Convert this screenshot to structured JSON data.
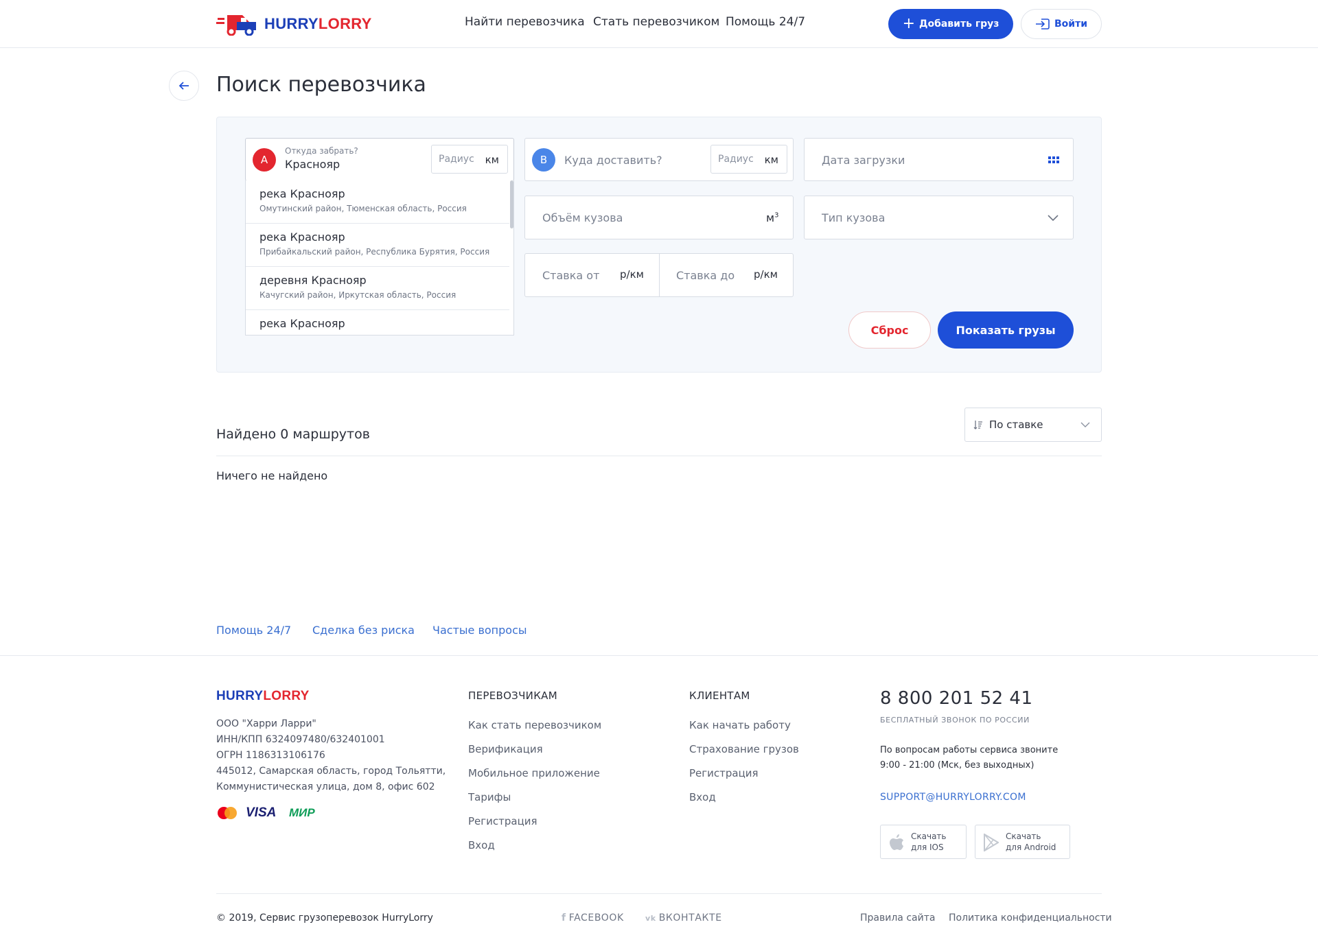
{
  "header": {
    "logo_part1": "HURRY",
    "logo_part2": "LORRY",
    "nav": [
      "Найти перевозчика",
      "Стать перевозчиком",
      "Помощь 24/7"
    ],
    "add_cargo": "Добавить груз",
    "login": "Войти"
  },
  "page": {
    "title": "Поиск перевозчика"
  },
  "search": {
    "from_pin": "A",
    "from_label": "Откуда забрать?",
    "from_value": "Краснояр",
    "to_pin": "B",
    "to_placeholder": "Куда доставить?",
    "radius_label": "Радиус",
    "radius_unit": "км",
    "date_placeholder": "Дата загрузки",
    "volume_placeholder": "Объём кузова",
    "volume_unit": "м",
    "volume_sup": "3",
    "body_type_placeholder": "Тип кузова",
    "rate_from_placeholder": "Ставка от",
    "rate_to_placeholder": "Ставка до",
    "rate_unit": "р/км",
    "reset": "Сброс",
    "show": "Показать грузы",
    "suggestions": [
      {
        "name": "река Краснояр",
        "sub": "Омутинский район, Тюменская область, Россия"
      },
      {
        "name": "река Краснояр",
        "sub": "Прибайкальский район, Республика Бурятия, Россия"
      },
      {
        "name": "деревня Краснояр",
        "sub": "Качугский район, Иркутская область, Россия"
      },
      {
        "name": "река Краснояр",
        "sub": ""
      }
    ]
  },
  "results": {
    "found": "Найдено 0 маршрутов",
    "sort_label": "По ставке",
    "empty": "Ничего не найдено"
  },
  "quick_links": [
    "Помощь 24/7",
    "Сделка без риска",
    "Частые вопросы"
  ],
  "footer": {
    "company": [
      "ООО \"Харри Ларри\"",
      "ИНН/КПП 6324097480/632401001",
      "ОГРН 1186313106176",
      "445012, Самарская область, город Тольятти,",
      "Коммунистическая улица, дом 8, офис 602"
    ],
    "payments": [
      "VISA",
      "МИР"
    ],
    "carriers_title": "ПЕРЕВОЗЧИКАМ",
    "carriers_links": [
      "Как стать перевозчиком",
      "Верификация",
      "Мобильное приложение",
      "Тарифы",
      "Регистрация",
      "Вход"
    ],
    "clients_title": "КЛИЕНТАМ",
    "clients_links": [
      "Как начать работу",
      "Страхование грузов",
      "Регистрация",
      "Вход"
    ],
    "phone": "8 800 201 52 41",
    "phone_note": "БЕСПЛАТНЫЙ ЗВОНОК ПО РОССИИ",
    "hours_line1": "По вопросам работы сервиса звоните",
    "hours_line2": "9:00 - 21:00 (Мск, без выходных)",
    "email": "SUPPORT@HURRYLORRY.COM",
    "ios_line1": "Скачать",
    "ios_line2": "для IOS",
    "android_line1": "Скачать",
    "android_line2": "для Android",
    "copyright": "© 2019, Сервис грузоперевозок HurryLorry",
    "facebook": "FACEBOOK",
    "vk": "ВКОНТАКТЕ",
    "rules": "Правила сайта",
    "privacy": "Политика конфиденциальности"
  },
  "colors": {
    "brand_blue": "#1e4fd8",
    "brand_red": "#e3262f",
    "pin_b": "#4a86e8",
    "link": "#3a6fd0"
  }
}
